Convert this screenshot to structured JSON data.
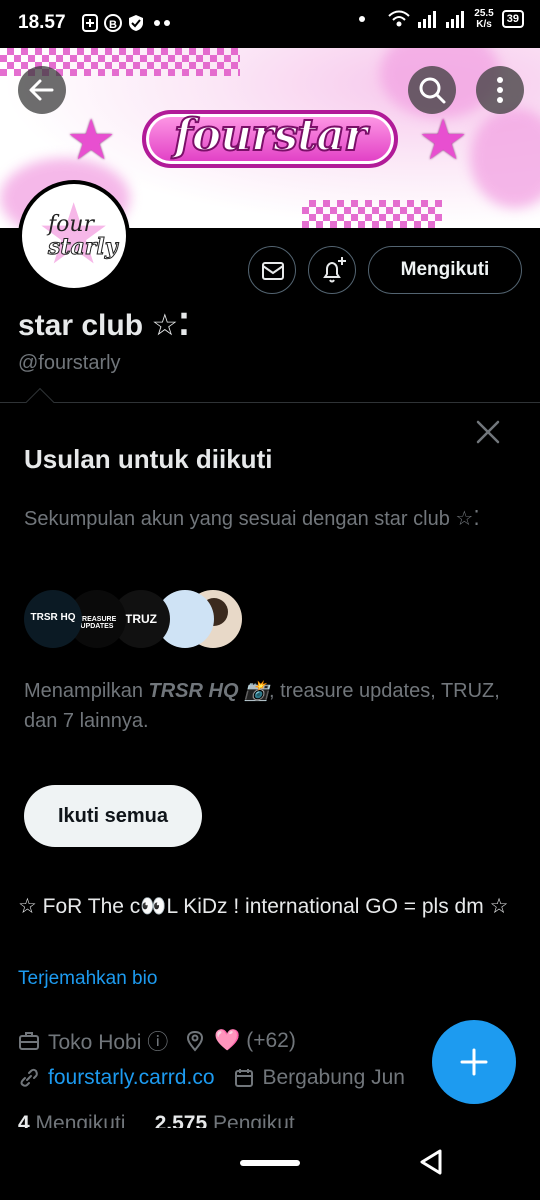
{
  "status_bar": {
    "time": "18.57",
    "net_speed_value": "25.5",
    "net_speed_unit": "K/s",
    "battery": "39"
  },
  "banner": {
    "logo_text": "fourstar"
  },
  "avatar": {
    "line1": "four",
    "line2": "starly"
  },
  "profile": {
    "name": "star club ☆⁚",
    "handle": "@fourstarly",
    "follow_button": "Mengikuti"
  },
  "suggestions": {
    "title": "Usulan untuk diikuti",
    "description": "Sekumpulan akun yang sesuai dengan star club ☆⁚",
    "avatars": [
      {
        "label": "TRSR HQ",
        "bg": "#0b1a24"
      },
      {
        "label": "TREASURE UPDATES",
        "bg": "#0a0a0a"
      },
      {
        "label": "TRUZ",
        "bg": "#111111"
      },
      {
        "label": "",
        "bg": "#cfe3f5"
      },
      {
        "label": "",
        "bg": "#e8d9c8"
      }
    ],
    "shown_prefix": "Menampilkan ",
    "shown_bold": "TRSR HQ 📸",
    "shown_suffix": ", treasure updates, TRUZ, dan 7 lainnya.",
    "follow_all": "Ikuti semua"
  },
  "bio": {
    "text": "☆ FoR The c👀L KiDz ! international GO = pls dm ☆",
    "translate": "Terjemahkan bio"
  },
  "meta": {
    "category": "Toko Hobi ⓘ",
    "location": "🩷 (+62)",
    "website": "fourstarly.carrd.co",
    "joined": "Bergabung Jun"
  },
  "counts": {
    "following_num": "4",
    "following_label": "Mengikuti",
    "followers_num": "2.575",
    "followers_label": "Pengikut"
  },
  "colors": {
    "accent": "#1d9bf0",
    "background": "#000000",
    "muted": "#71767b"
  }
}
